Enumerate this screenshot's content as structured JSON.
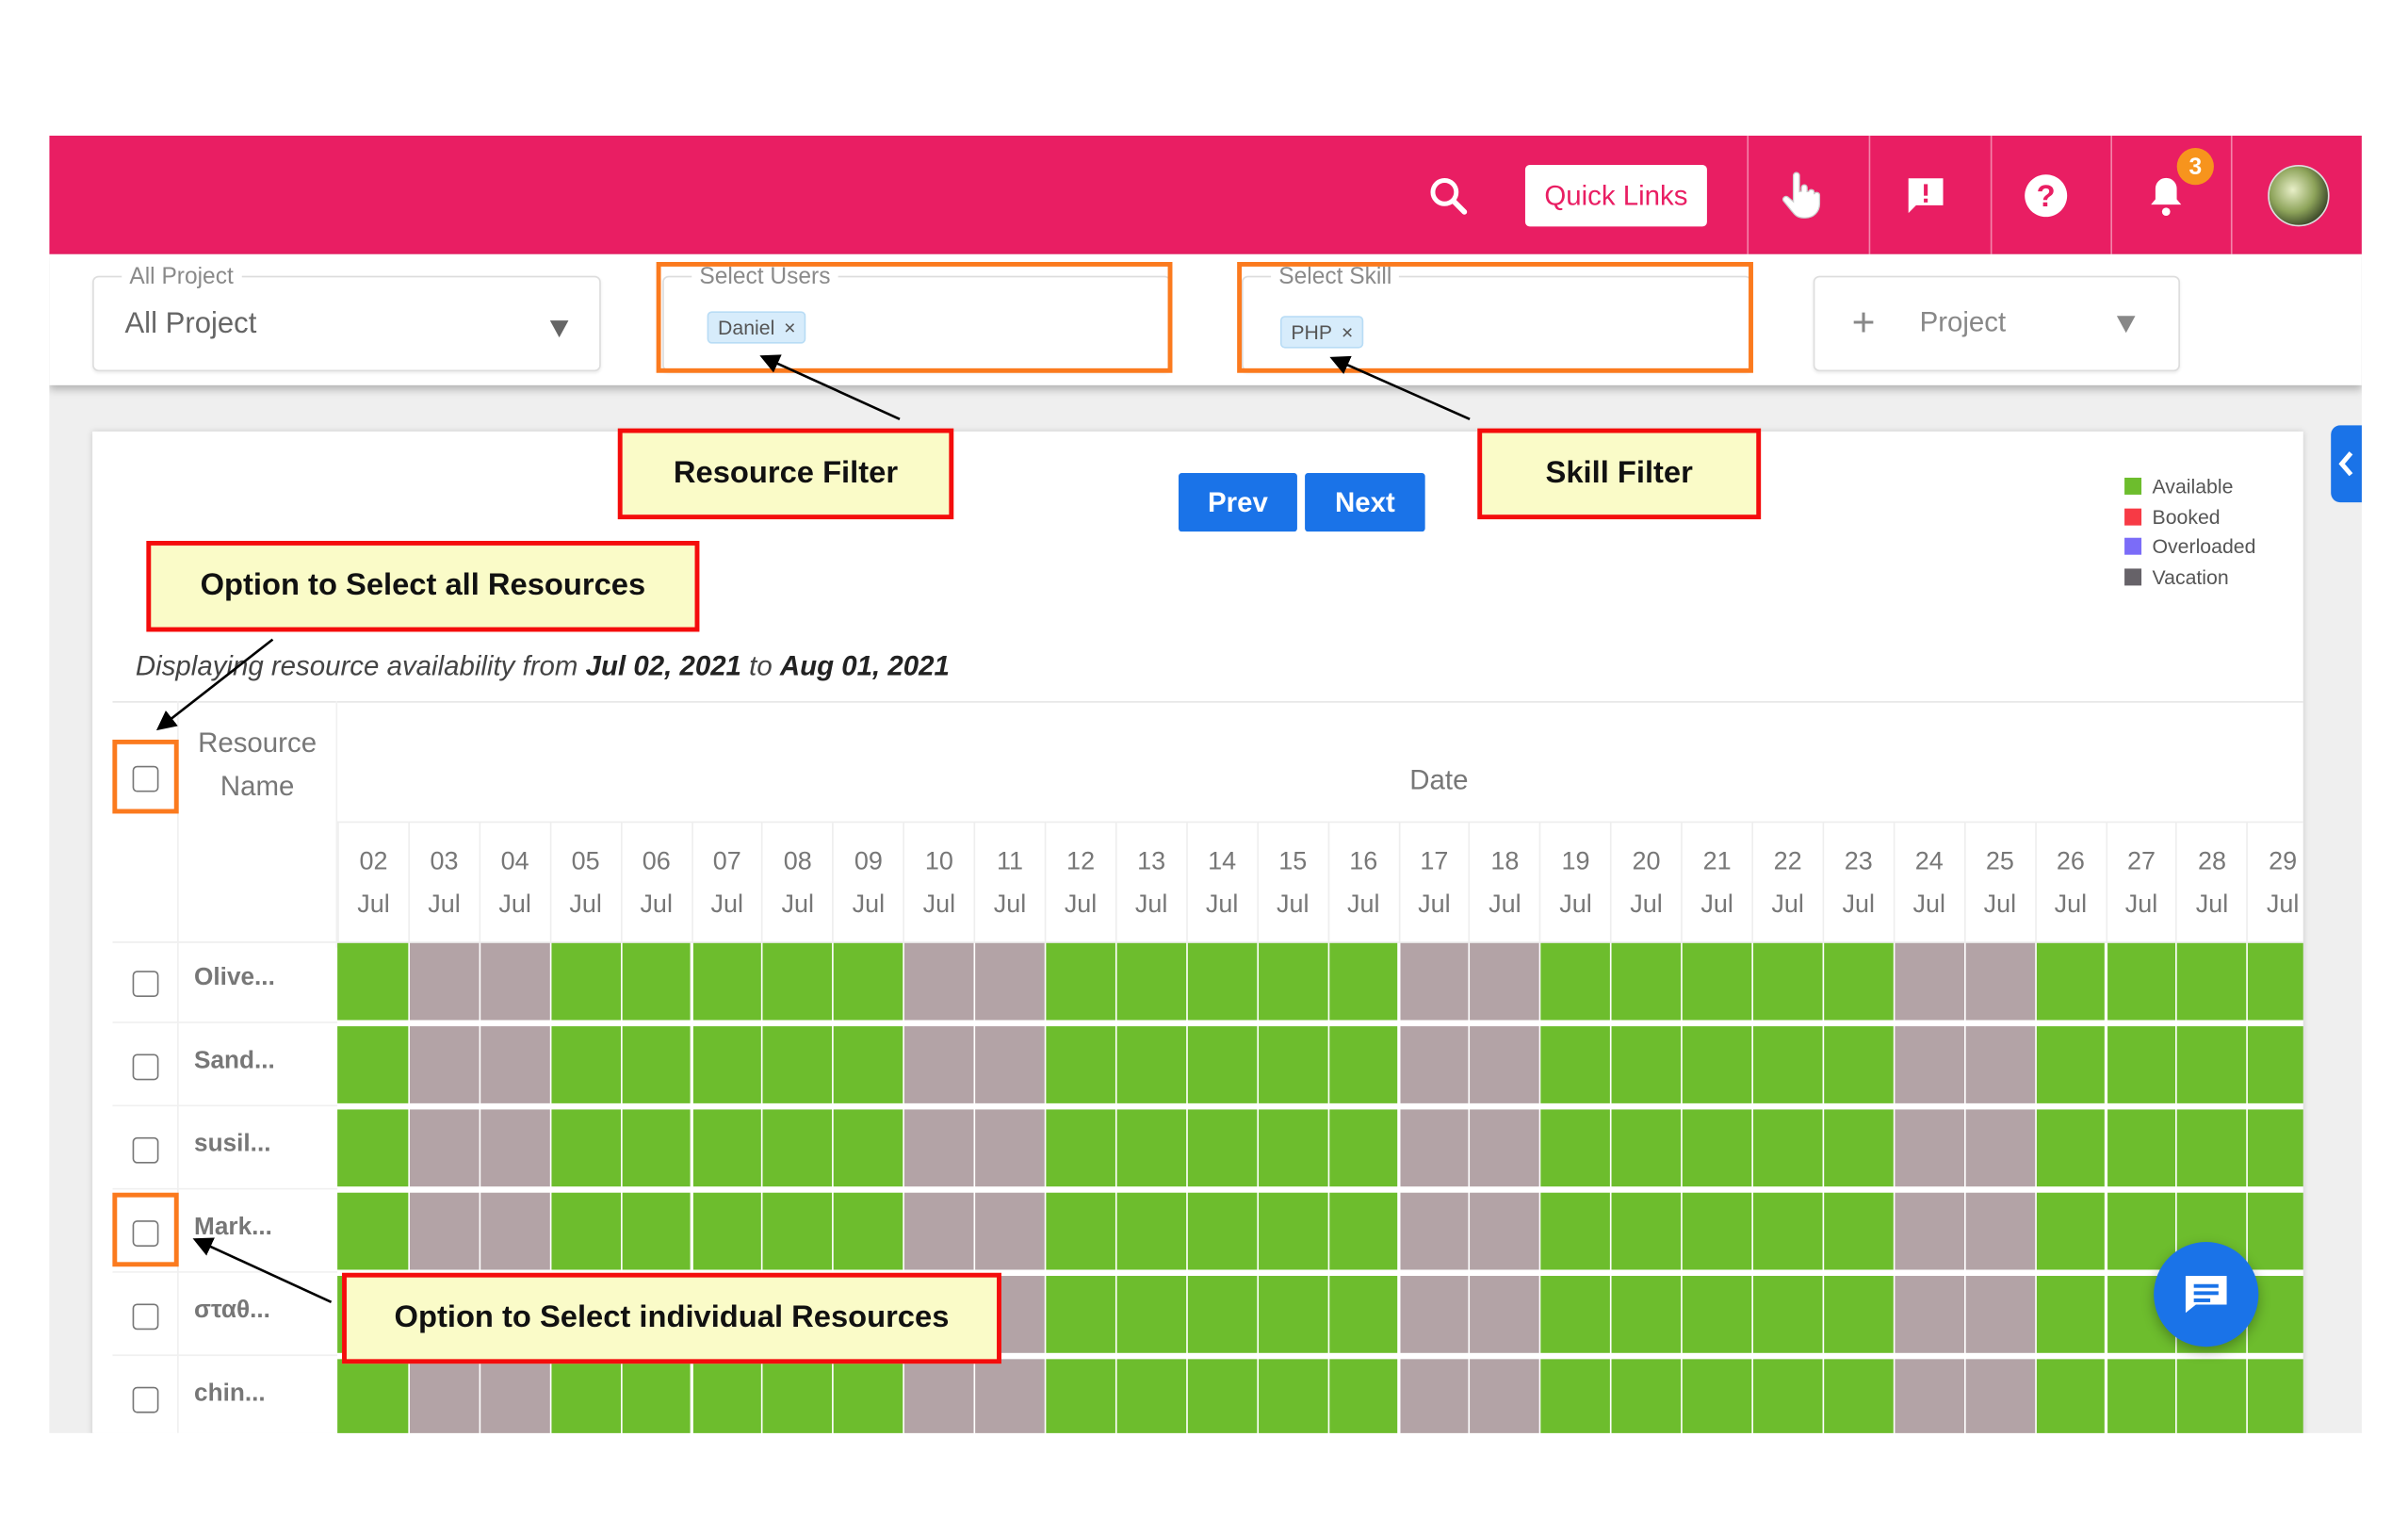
{
  "header": {
    "quick_links_label": "Quick Links",
    "notification_count": "3",
    "icons": [
      "search-icon",
      "hand-pointer-icon",
      "feedback-icon",
      "help-icon",
      "bell-icon",
      "avatar"
    ],
    "brand_color": "#e91e63"
  },
  "filters": {
    "project": {
      "label": "All Project",
      "value": "All Project"
    },
    "users": {
      "label": "Select Users",
      "chips": [
        "Daniel"
      ]
    },
    "skill": {
      "label": "Select Skill",
      "chips": [
        "PHP"
      ]
    },
    "add_project": {
      "label": "Project"
    }
  },
  "nav": {
    "prev_label": "Prev",
    "next_label": "Next"
  },
  "legend": [
    {
      "label": "Available",
      "color": "#6dbd2d"
    },
    {
      "label": "Booked",
      "color": "#f73a45"
    },
    {
      "label": "Overloaded",
      "color": "#7b6cf8"
    },
    {
      "label": "Vacation",
      "color": "#666268"
    }
  ],
  "display": {
    "prefix": "Displaying resource availability from",
    "from": "Jul 02, 2021",
    "middle": "to",
    "to": "Aug 01, 2021"
  },
  "table": {
    "resource_header_line1": "Resource",
    "resource_header_line2": "Name",
    "date_header": "Date",
    "dates": [
      {
        "day": "02",
        "month": "Jul"
      },
      {
        "day": "03",
        "month": "Jul"
      },
      {
        "day": "04",
        "month": "Jul"
      },
      {
        "day": "05",
        "month": "Jul"
      },
      {
        "day": "06",
        "month": "Jul"
      },
      {
        "day": "07",
        "month": "Jul"
      },
      {
        "day": "08",
        "month": "Jul"
      },
      {
        "day": "09",
        "month": "Jul"
      },
      {
        "day": "10",
        "month": "Jul"
      },
      {
        "day": "11",
        "month": "Jul"
      },
      {
        "day": "12",
        "month": "Jul"
      },
      {
        "day": "13",
        "month": "Jul"
      },
      {
        "day": "14",
        "month": "Jul"
      },
      {
        "day": "15",
        "month": "Jul"
      },
      {
        "day": "16",
        "month": "Jul"
      },
      {
        "day": "17",
        "month": "Jul"
      },
      {
        "day": "18",
        "month": "Jul"
      },
      {
        "day": "19",
        "month": "Jul"
      },
      {
        "day": "20",
        "month": "Jul"
      },
      {
        "day": "21",
        "month": "Jul"
      },
      {
        "day": "22",
        "month": "Jul"
      },
      {
        "day": "23",
        "month": "Jul"
      },
      {
        "day": "24",
        "month": "Jul"
      },
      {
        "day": "25",
        "month": "Jul"
      },
      {
        "day": "26",
        "month": "Jul"
      },
      {
        "day": "27",
        "month": "Jul"
      },
      {
        "day": "28",
        "month": "Jul"
      },
      {
        "day": "29",
        "month": "Jul"
      }
    ],
    "cell_colors": {
      "A": "#6dbd2d",
      "W": "#b3a3a6"
    },
    "rows": [
      {
        "name": "Olive...",
        "cells": "AWWAAAAAWWAAAAAWWAAAAAWWAAAA"
      },
      {
        "name": "Sand...",
        "cells": "AWWAAAAAWWAAAAAWWAAAAAWWAAAA"
      },
      {
        "name": "susil...",
        "cells": "AWWAAAAAWWAAAAAWWAAAAAWWAAAA"
      },
      {
        "name": "Mark...",
        "cells": "AWWAAAAAWWAAAAAWWAAAAAWWAAAA"
      },
      {
        "name": "σταθ...",
        "cells": "AWWAAAAAWWAAAAAWWAAAAAWWAAAA"
      },
      {
        "name": "chin...",
        "cells": "AWWAAAAAWWAAAAAWWAAAAAWWAAAA"
      }
    ]
  },
  "annotations": {
    "resource_filter": "Resource Filter",
    "skill_filter": "Skill Filter",
    "select_all": "Option to Select all Resources",
    "select_individual": "Option to Select individual Resources"
  }
}
